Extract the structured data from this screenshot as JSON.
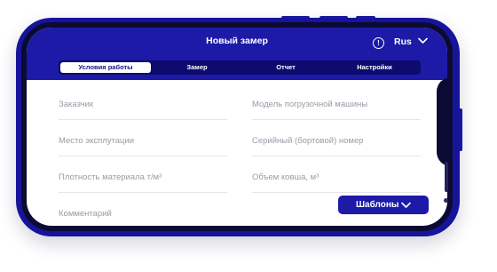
{
  "header": {
    "title": "Новый замер",
    "info_icon": "info-icon",
    "language": "Rus",
    "language_icon": "chevron-down-icon"
  },
  "tabs": [
    {
      "label": "Условия работы",
      "active": true
    },
    {
      "label": "Замер",
      "active": false
    },
    {
      "label": "Отчет",
      "active": false
    },
    {
      "label": "Настройки",
      "active": false
    }
  ],
  "form": {
    "customer_placeholder": "Заказчик",
    "machine_model_placeholder": "Модель погрузочной машины",
    "location_placeholder": "Место эксплутации",
    "serial_number_placeholder": "Серийный (бортовой) номер",
    "density_placeholder": "Плотность материала т/м³",
    "bucket_volume_placeholder": "Объем ковша, м³",
    "comment_placeholder": "Комментарий"
  },
  "templates_button": {
    "label": "Шаблоны",
    "icon": "chevron-down-icon"
  },
  "colors": {
    "brand": "#1d1aa7",
    "tabs_background": "#0d0b6d",
    "placeholder_text": "#9a9aa6"
  }
}
